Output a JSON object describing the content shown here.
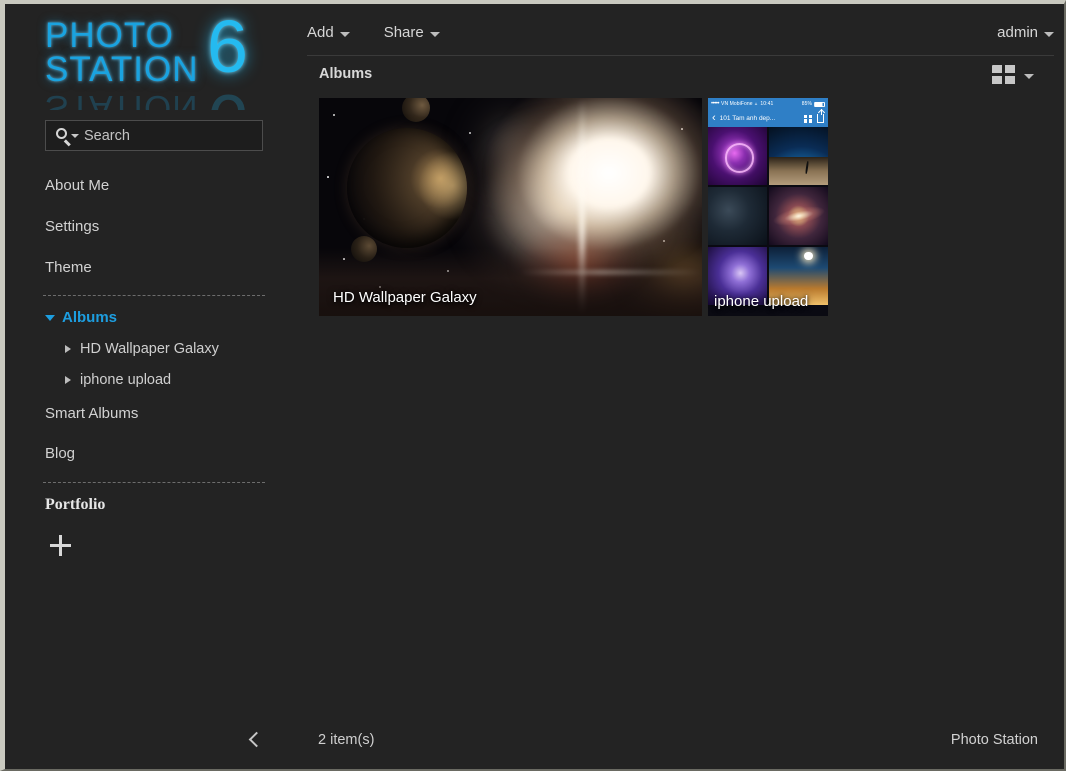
{
  "app": {
    "brand_line1": "PHOTO",
    "brand_line2": "STATION",
    "brand_version": "6",
    "accent_color": "#1d9ee0",
    "background_color": "#232323"
  },
  "search": {
    "placeholder": "Search",
    "value": ""
  },
  "sidebar": {
    "links": [
      {
        "label": "About Me",
        "name": "about-me"
      },
      {
        "label": "Settings",
        "name": "settings"
      },
      {
        "label": "Theme",
        "name": "theme"
      }
    ],
    "albums_section": {
      "label": "Albums",
      "expanded": true,
      "children": [
        {
          "label": "HD Wallpaper Galaxy"
        },
        {
          "label": "iphone upload"
        }
      ]
    },
    "links_after": [
      {
        "label": "Smart Albums",
        "name": "smart-albums"
      },
      {
        "label": "Blog",
        "name": "blog"
      }
    ],
    "portfolio": {
      "label": "Portfolio",
      "add_label": "+"
    }
  },
  "toolbar": {
    "add_label": "Add",
    "share_label": "Share",
    "user_label": "admin"
  },
  "content": {
    "section_title": "Albums",
    "view_mode": "grid",
    "albums": [
      {
        "title": "HD Wallpaper Galaxy",
        "thumbnail": "galaxy-nebula-planet"
      },
      {
        "title": "iphone upload",
        "thumbnail": "iphone-screenshot-photo-grid",
        "screenshot": {
          "carrier": "VN MobiFone",
          "time": "10:41",
          "battery": "85%",
          "nav_title": "101 Tam anh dep..."
        }
      }
    ]
  },
  "footer": {
    "item_count": "2 item(s)",
    "brand": "Photo Station"
  }
}
